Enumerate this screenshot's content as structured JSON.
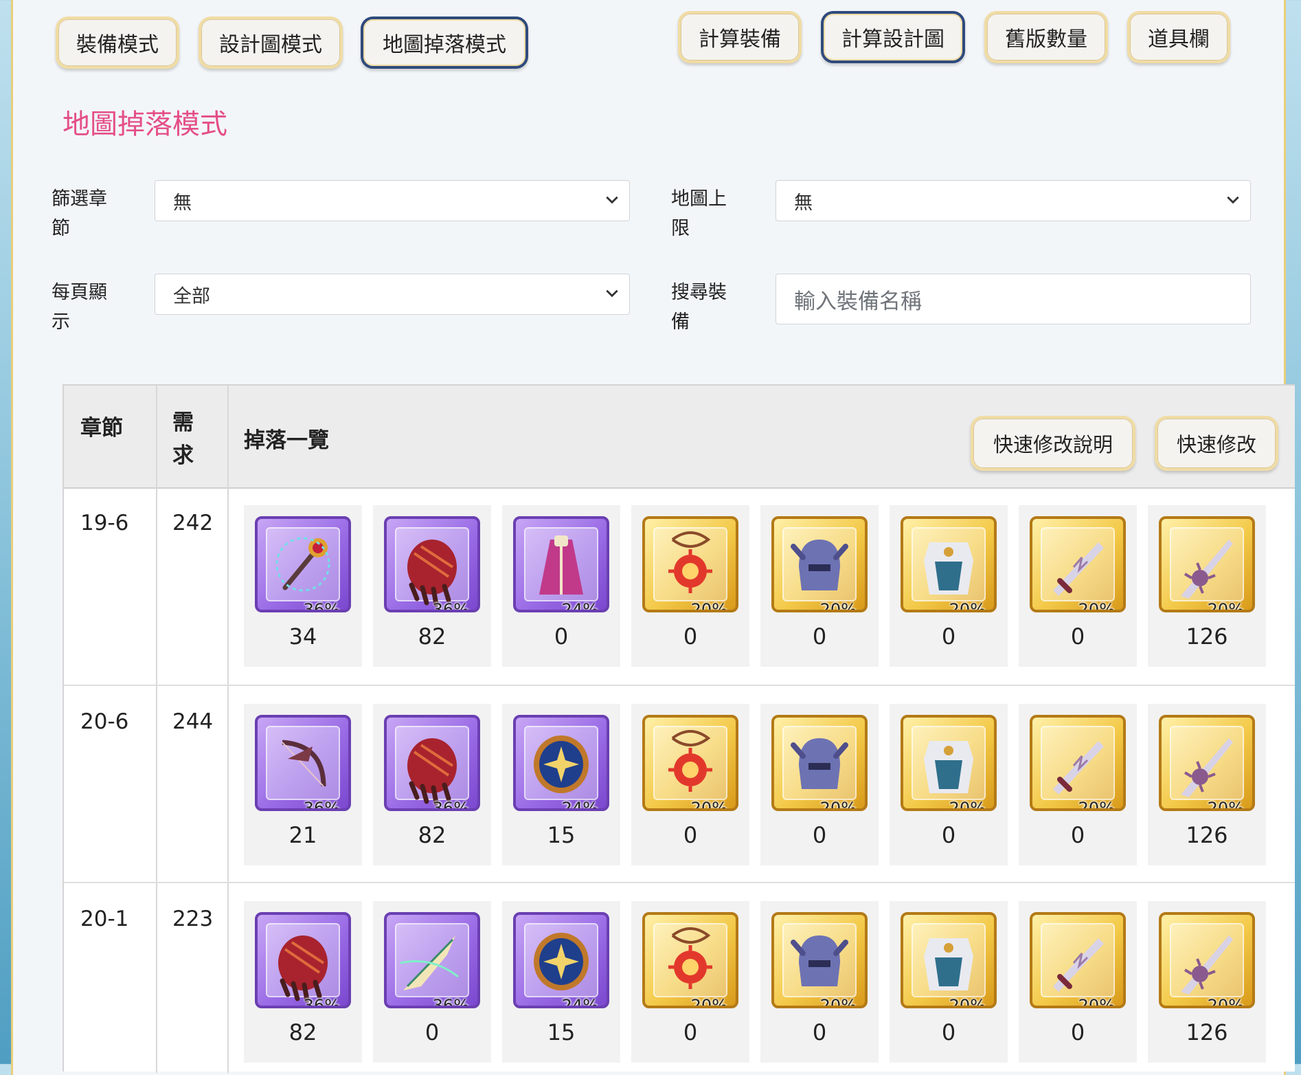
{
  "modes": [
    "裝備模式",
    "設計圖模式",
    "地圖掉落模式"
  ],
  "actions": [
    "計算裝備",
    "計算設計圖",
    "舊版數量",
    "道具欄"
  ],
  "title": "地圖掉落模式",
  "filters": {
    "chapter_label": "篩選章節",
    "chapter_value": "無",
    "map_cap_label": "地圖上限",
    "map_cap_value": "無",
    "per_page_label": "每頁顯示",
    "per_page_value": "全部",
    "search_label": "搜尋裝備",
    "search_placeholder": "輸入裝備名稱"
  },
  "table": {
    "col_chapter": "章節",
    "col_need": "需求",
    "col_drops": "掉落一覽",
    "quick_help": "快速修改說明",
    "quick_edit": "快速修改"
  },
  "rows": [
    {
      "chapter": "19-6",
      "need": "242",
      "items": [
        {
          "rarity": "purple",
          "icon": "staff-icon",
          "pct": "36%",
          "count": "34"
        },
        {
          "rarity": "purple",
          "icon": "claw-gauntlet-icon",
          "pct": "36%",
          "count": "82"
        },
        {
          "rarity": "purple",
          "icon": "robe-icon",
          "pct": "24%",
          "count": "0"
        },
        {
          "rarity": "gold",
          "icon": "amulet-icon",
          "pct": "20%",
          "count": "0"
        },
        {
          "rarity": "gold",
          "icon": "helmet-icon",
          "pct": "20%",
          "count": "0"
        },
        {
          "rarity": "gold",
          "icon": "armor-icon",
          "pct": "20%",
          "count": "0"
        },
        {
          "rarity": "gold",
          "icon": "sword-icon",
          "pct": "20%",
          "count": "0"
        },
        {
          "rarity": "gold",
          "icon": "spiked-blade-icon",
          "pct": "20%",
          "count": "126"
        }
      ]
    },
    {
      "chapter": "20-6",
      "need": "244",
      "items": [
        {
          "rarity": "purple",
          "icon": "bow-icon",
          "pct": "36%",
          "count": "21"
        },
        {
          "rarity": "purple",
          "icon": "claw-gauntlet-icon",
          "pct": "36%",
          "count": "82"
        },
        {
          "rarity": "purple",
          "icon": "orb-shield-icon",
          "pct": "24%",
          "count": "15"
        },
        {
          "rarity": "gold",
          "icon": "amulet-icon",
          "pct": "20%",
          "count": "0"
        },
        {
          "rarity": "gold",
          "icon": "helmet-icon",
          "pct": "20%",
          "count": "0"
        },
        {
          "rarity": "gold",
          "icon": "armor-icon",
          "pct": "20%",
          "count": "0"
        },
        {
          "rarity": "gold",
          "icon": "sword-icon",
          "pct": "20%",
          "count": "0"
        },
        {
          "rarity": "gold",
          "icon": "spiked-blade-icon",
          "pct": "20%",
          "count": "126"
        }
      ]
    },
    {
      "chapter": "20-1",
      "need": "223",
      "items": [
        {
          "rarity": "purple",
          "icon": "claw-gauntlet-icon",
          "pct": "36%",
          "count": "82"
        },
        {
          "rarity": "purple",
          "icon": "drill-lance-icon",
          "pct": "36%",
          "count": "0"
        },
        {
          "rarity": "purple",
          "icon": "orb-shield-icon",
          "pct": "24%",
          "count": "15"
        },
        {
          "rarity": "gold",
          "icon": "amulet-icon",
          "pct": "20%",
          "count": "0"
        },
        {
          "rarity": "gold",
          "icon": "helmet-icon",
          "pct": "20%",
          "count": "0"
        },
        {
          "rarity": "gold",
          "icon": "armor-icon",
          "pct": "20%",
          "count": "0"
        },
        {
          "rarity": "gold",
          "icon": "sword-icon",
          "pct": "20%",
          "count": "0"
        },
        {
          "rarity": "gold",
          "icon": "spiked-blade-icon",
          "pct": "20%",
          "count": "126"
        }
      ]
    }
  ],
  "colors": {
    "accent_title": "#e44e88",
    "active_border": "#2f4a7d",
    "button_border": "#f0dca4"
  }
}
